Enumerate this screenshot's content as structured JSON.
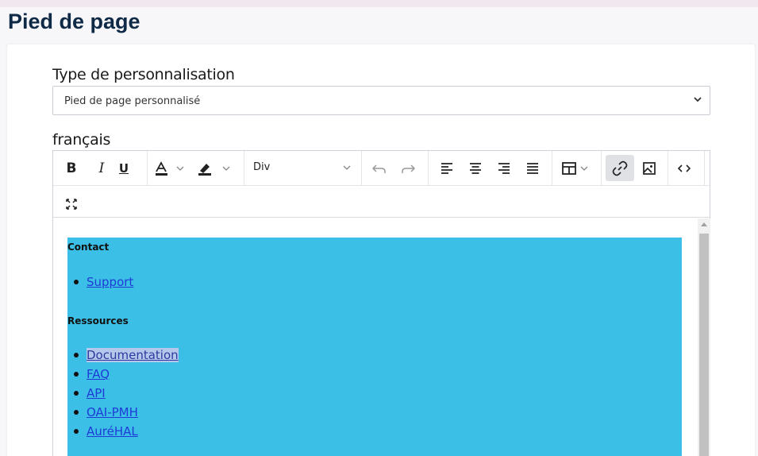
{
  "page": {
    "title": "Pied de page"
  },
  "customization": {
    "label": "Type de personnalisation",
    "selected": "Pied de page personnalisé"
  },
  "language": {
    "label": "français"
  },
  "toolbar": {
    "bold": "B",
    "italic": "I",
    "underline": "U",
    "block_format": "Div"
  },
  "content": {
    "sections": [
      {
        "title": "Contact",
        "links": [
          "Support"
        ]
      },
      {
        "title": "Ressources",
        "links": [
          "Documentation",
          "FAQ",
          "API",
          "OAI-PMH",
          "AuréHAL"
        ]
      }
    ]
  },
  "colors": {
    "block_background": "#3bbfe6",
    "title": "#0e2a47",
    "link": "#1f3bd6"
  }
}
